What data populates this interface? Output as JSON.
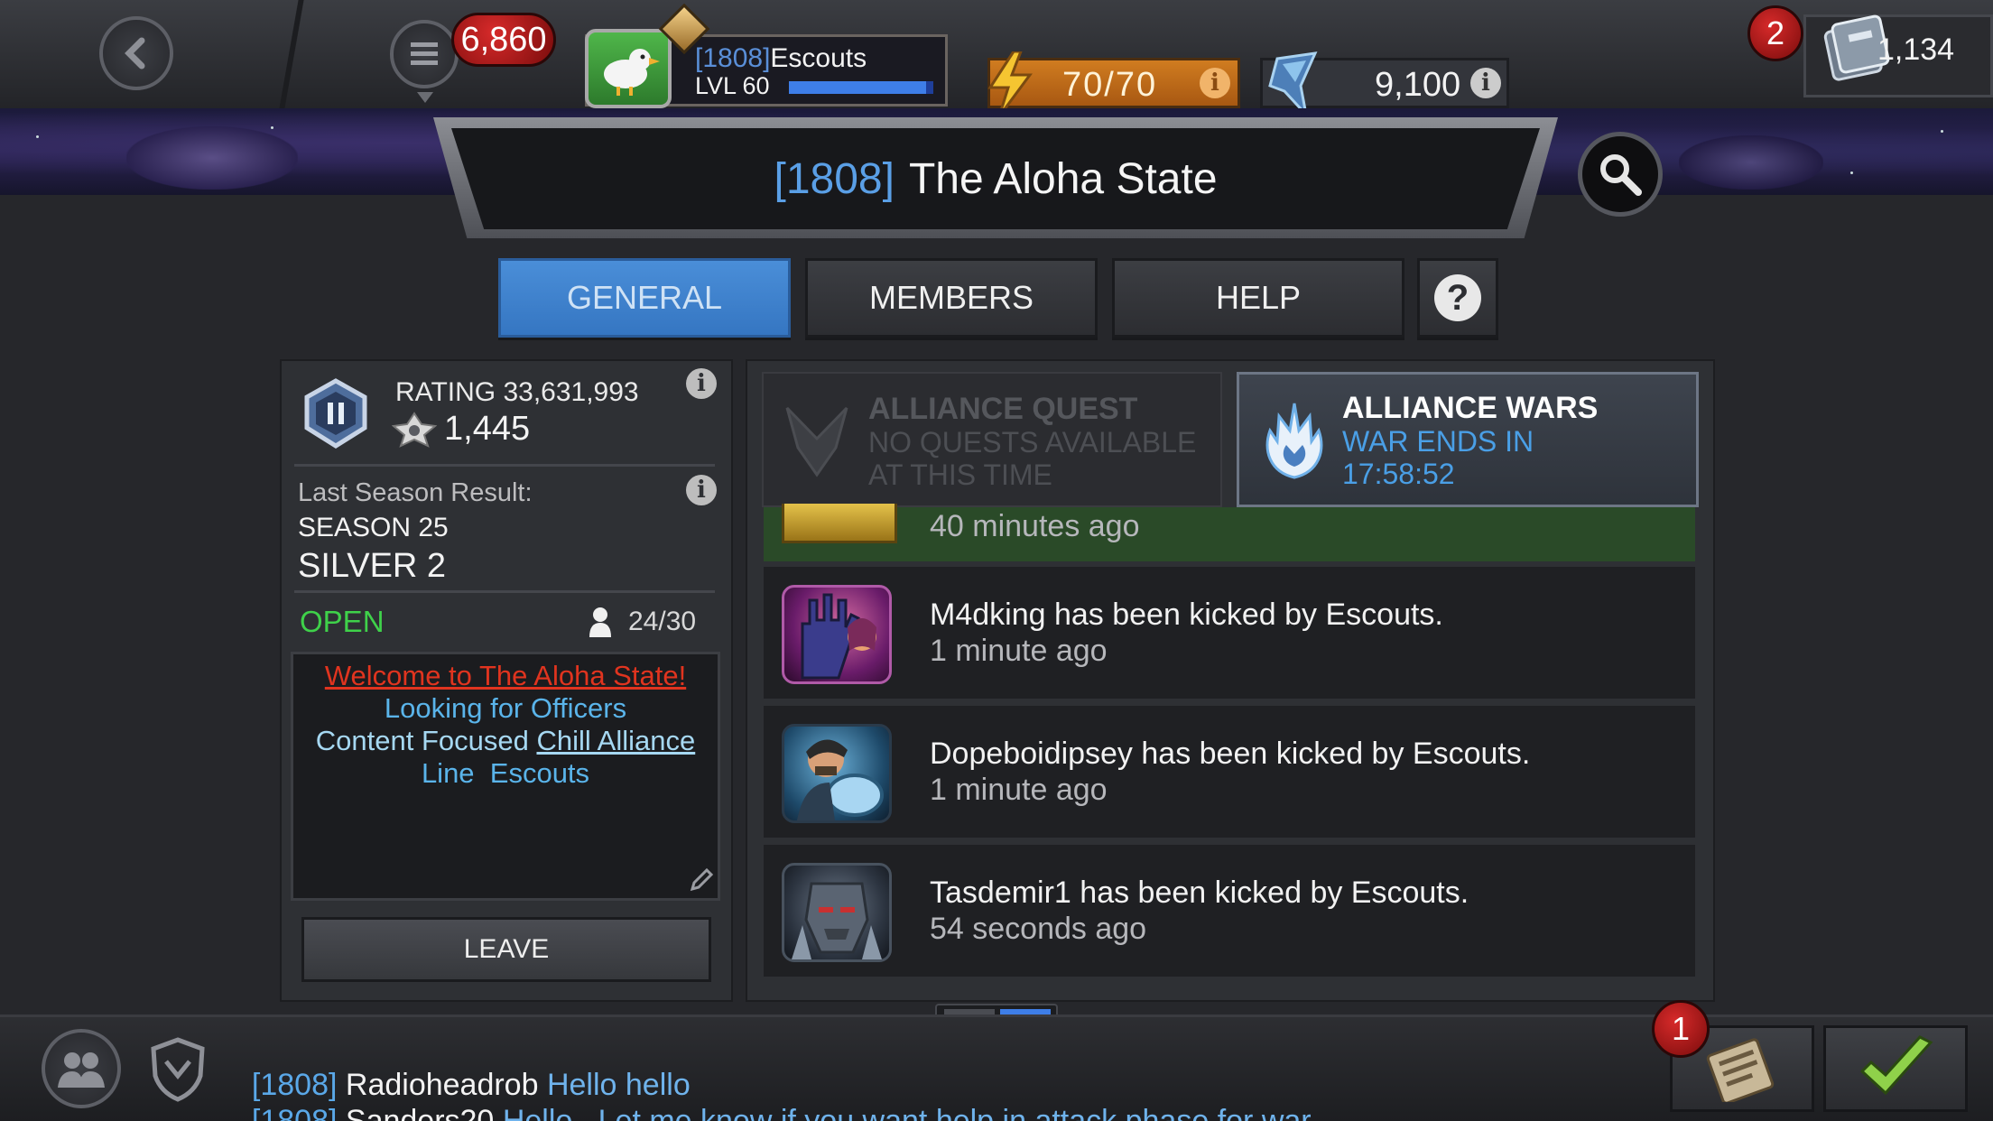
{
  "topbar": {
    "crystals_count": "6,860",
    "profile": {
      "alliance_tag": "[1808]",
      "name": "Escouts",
      "level": "LVL 60",
      "xp_fraction": 0.95
    },
    "energy": "70/70",
    "units": "9,100",
    "gold_notification_count": "2",
    "gold": "1,134"
  },
  "alliance": {
    "tag": "[1808]",
    "name": "The Aloha State"
  },
  "tabs": [
    {
      "label": "GENERAL",
      "active": true
    },
    {
      "label": "MEMBERS",
      "active": false
    },
    {
      "label": "HELP",
      "active": false
    }
  ],
  "info_panel": {
    "rating_label": "RATING 33,631,993",
    "war_rating": "1,445",
    "last_season_label": "Last Season Result:",
    "season": "SEASON 25",
    "tier": "SILVER 2",
    "status": "OPEN",
    "members_count": "24/30",
    "motd": {
      "line1": "Welcome to The Aloha State!",
      "line2": "Looking for Officers",
      "line3_a": "Content Focused ",
      "line3_b": "Chill Alliance",
      "line4": "Line  Escouts"
    },
    "leave_label": "LEAVE"
  },
  "quest_card": {
    "title": "ALLIANCE QUEST",
    "line1": "NO QUESTS AVAILABLE",
    "line2": "AT THIS TIME"
  },
  "war_card": {
    "title": "ALLIANCE WARS",
    "line1": "WAR ENDS IN",
    "timer": "17:58:52"
  },
  "feed": [
    {
      "message": "",
      "time": "40 minutes ago",
      "icon": "gold-trophy-icon"
    },
    {
      "message": "M4dking has been kicked by Escouts.",
      "time": "1 minute ago",
      "icon": "champion-portrait-icon"
    },
    {
      "message": "Dopeboidipsey has been kicked by Escouts.",
      "time": "1 minute ago",
      "icon": "champion-portrait-icon"
    },
    {
      "message": "Tasdemir1 has been kicked by Escouts.",
      "time": "54 seconds ago",
      "icon": "champion-portrait-icon"
    }
  ],
  "chat": [
    {
      "channel": "[1808]",
      "name": "Radioheadrob",
      "text": "Hello hello"
    },
    {
      "channel": "[1808]",
      "name": "Sanders20",
      "text": "Hello.  Let me know if you want help in attack phase for war."
    }
  ],
  "quests_notification_count": "1",
  "colors": {
    "active_tab": "#3f86d0",
    "open_status": "#3fd14a",
    "war_timer": "#4a9fe6",
    "motd_red": "#e0341f",
    "motd_blue": "#5ab4ea",
    "feed_highlight": "#2a4a28"
  }
}
